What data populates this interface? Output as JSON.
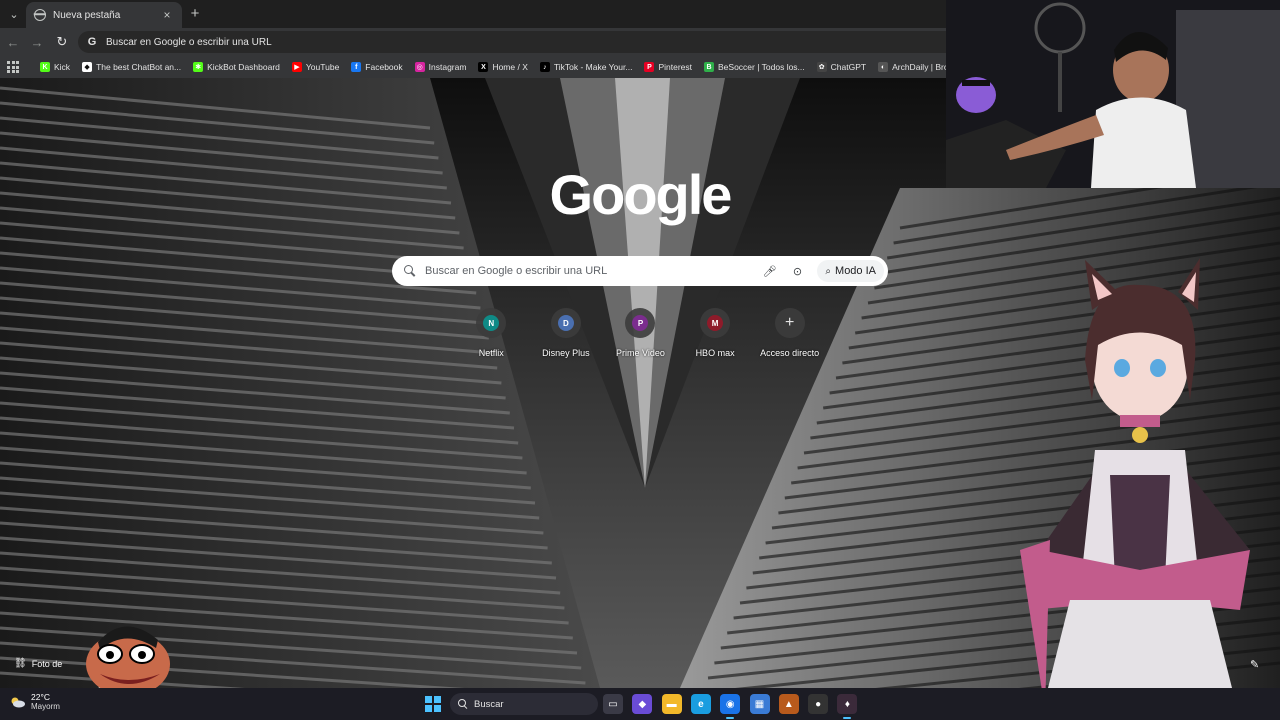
{
  "browser": {
    "tab": {
      "title": "Nueva pestaña",
      "close": "×"
    },
    "new_tab": "+",
    "omnibox": {
      "text": "Buscar en Google o escribir una URL"
    },
    "bookmarks": [
      {
        "label": "Kick",
        "icon": "kick-icon",
        "color": "#53fc18",
        "glyph": "K"
      },
      {
        "label": "The best ChatBot an...",
        "icon": "chatbot-icon",
        "color": "#ffffff",
        "glyph": "◆"
      },
      {
        "label": "KickBot Dashboard",
        "icon": "kickbot-icon",
        "color": "#53fc18",
        "glyph": "✱"
      },
      {
        "label": "YouTube",
        "icon": "youtube-icon",
        "color": "#ff0000",
        "glyph": "▶"
      },
      {
        "label": "Facebook",
        "icon": "facebook-icon",
        "color": "#1877f2",
        "glyph": "f"
      },
      {
        "label": "Instagram",
        "icon": "instagram-icon",
        "color": "#d6249f",
        "glyph": "◎"
      },
      {
        "label": "Home / X",
        "icon": "x-icon",
        "color": "#000000",
        "glyph": "X"
      },
      {
        "label": "TikTok - Make Your...",
        "icon": "tiktok-icon",
        "color": "#000000",
        "glyph": "♪"
      },
      {
        "label": "Pinterest",
        "icon": "pinterest-icon",
        "color": "#e60023",
        "glyph": "P"
      },
      {
        "label": "BeSoccer | Todos los...",
        "icon": "besoccer-icon",
        "color": "#2fb04a",
        "glyph": "B"
      },
      {
        "label": "ChatGPT",
        "icon": "chatgpt-icon",
        "color": "#444444",
        "glyph": "✿"
      },
      {
        "label": "ArchDaily | Broadca...",
        "icon": "archdaily-icon",
        "color": "#555555",
        "glyph": "◐"
      }
    ]
  },
  "newtab": {
    "logo": "Google",
    "search": {
      "placeholder": "Buscar en Google o escribir una URL",
      "mode_label": "Modo IA"
    },
    "shortcuts": [
      {
        "label": "Netflix",
        "letter": "N",
        "color": "#0f8a86"
      },
      {
        "label": "Disney Plus",
        "letter": "D",
        "color": "#4a6fb0"
      },
      {
        "label": "Prime Video",
        "letter": "P",
        "color": "#7b2d8e"
      },
      {
        "label": "HBO max",
        "letter": "M",
        "color": "#8e1b2a"
      },
      {
        "label": "Acceso directo",
        "letter": "+",
        "color": ""
      }
    ],
    "photo_credit": "Foto de"
  },
  "taskbar": {
    "weather": {
      "temp": "22°C",
      "condition": "Mayorm"
    },
    "search_label": "Buscar",
    "apps": [
      {
        "name": "task-view",
        "glyph": "▭",
        "color": "#3a3a46"
      },
      {
        "name": "copilot",
        "glyph": "◆",
        "color": "#6a4cd6"
      },
      {
        "name": "file-explorer",
        "glyph": "▬",
        "color": "#f2b82a"
      },
      {
        "name": "edge",
        "glyph": "e",
        "color": "#1a9de0"
      },
      {
        "name": "chrome",
        "glyph": "◉",
        "color": "#1a73e8"
      },
      {
        "name": "store",
        "glyph": "▦",
        "color": "#3a7bd5"
      },
      {
        "name": "game-app",
        "glyph": "▲",
        "color": "#b85a1c"
      },
      {
        "name": "obs",
        "glyph": "●",
        "color": "#333333"
      },
      {
        "name": "vtuber-app",
        "glyph": "♦",
        "color": "#3b2a3a"
      }
    ]
  }
}
